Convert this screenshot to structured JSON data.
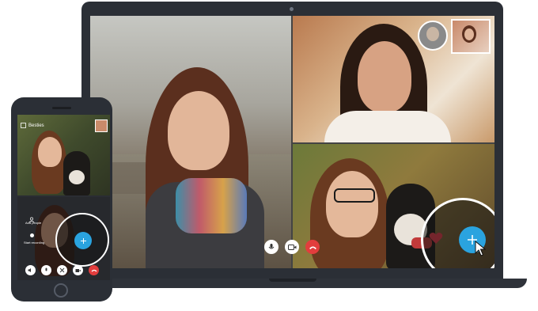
{
  "phone": {
    "chat_title": "Besties",
    "menu_item_1": "Add people",
    "menu_item_2": "Start recording"
  },
  "colors": {
    "accent": "#2aa3df",
    "end_call": "#e23d3d",
    "heart": "#e83a4a",
    "device": "#2b2f36"
  },
  "icons": {
    "mic": "microphone-icon",
    "video": "video-camera-icon",
    "end": "end-call-icon",
    "heart": "heart-icon",
    "add": "plus-icon"
  }
}
